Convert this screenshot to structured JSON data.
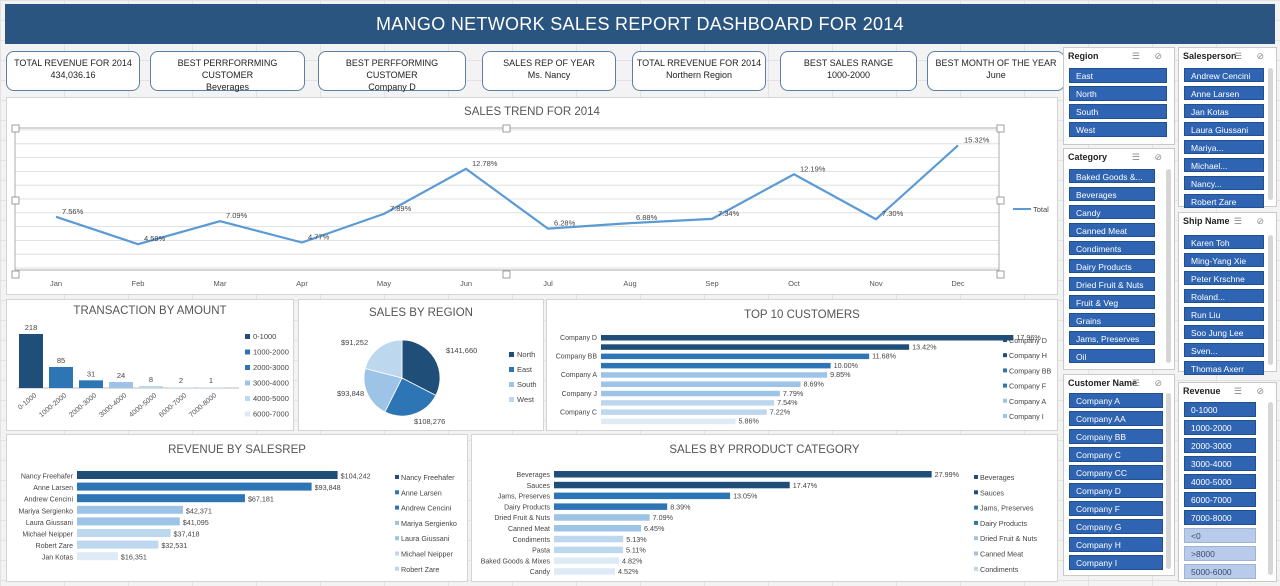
{
  "title": "MANGO NETWORK SALES REPORT DASHBOARD FOR 2014",
  "kpis": [
    {
      "label": "TOTAL REVENUE FOR 2014",
      "value": "434,036.16"
    },
    {
      "label": "BEST PERRFORRMING CUSTOMER",
      "value": "Beverages"
    },
    {
      "label": "BEST PERFFORMING CUSTOMER",
      "value": "Company D"
    },
    {
      "label": "SALES REP OF YEAR",
      "value": "Ms. Nancy"
    },
    {
      "label": "TOTAL RREVENUE FOR 2014",
      "value": "Northern Region"
    },
    {
      "label": "BEST SALES RANGE",
      "value": "1000-2000"
    },
    {
      "label": "BEST MONTH OF THE YEAR",
      "value": "June"
    }
  ],
  "colors": {
    "dark": "#1f4e79",
    "mid": "#2e75b6",
    "light": "#9dc3e6",
    "lighter": "#bdd7ee",
    "lightest": "#deebf7",
    "line": "#5b9bd5",
    "slicer": "#2f64b2"
  },
  "chart_data": [
    {
      "type": "line",
      "title": "SALES TREND FOR 2014",
      "categories": [
        "Jan",
        "Feb",
        "Mar",
        "Apr",
        "May",
        "Jun",
        "Jul",
        "Aug",
        "Sep",
        "Oct",
        "Nov",
        "Dec"
      ],
      "series": [
        {
          "name": "Total",
          "values": [
            7.56,
            4.59,
            7.09,
            4.77,
            7.89,
            12.78,
            6.28,
            6.88,
            7.34,
            12.19,
            7.3,
            15.32
          ],
          "labels": [
            "7.56%",
            "4.59%",
            "7.09%",
            "4.77%",
            "7.89%",
            "12.78%",
            "6.28%",
            "6.88%",
            "7.34%",
            "12.19%",
            "7.30%",
            "15.32%"
          ]
        }
      ],
      "grid": true,
      "legend": "right"
    },
    {
      "type": "bar",
      "title": "TRANSACTION BY AMOUNT",
      "categories": [
        "0-1000",
        "1000-2000",
        "2000-3000",
        "3000-4000",
        "4000-5000",
        "6000-7000",
        "7000-8000"
      ],
      "values": [
        218,
        85,
        31,
        24,
        8,
        2,
        1
      ],
      "legend": [
        "0-1000",
        "1000-2000",
        "2000-3000",
        "3000-4000",
        "4000-5000",
        "6000-7000"
      ]
    },
    {
      "type": "pie",
      "title": "SALES BY REGION",
      "categories": [
        "North",
        "East",
        "South",
        "West"
      ],
      "values": [
        141660,
        108276,
        93848,
        91252
      ],
      "labels": [
        "$141,660",
        "$108,276",
        "$93,848",
        "$91,252"
      ]
    },
    {
      "type": "bar",
      "title": "TOP 10 CUSTOMERS",
      "categories": [
        "Company D",
        "",
        "Company BB",
        "",
        "Company A",
        "",
        "Company J",
        "",
        "Company C",
        ""
      ],
      "values": [
        17.96,
        13.42,
        11.68,
        10.0,
        9.85,
        8.69,
        7.79,
        7.54,
        7.22,
        5.86
      ],
      "labels": [
        "17.96%",
        "13.42%",
        "11.68%",
        "10.00%",
        "9.85%",
        "8.69%",
        "7.79%",
        "7.54%",
        "7.22%",
        "5.86%"
      ],
      "legend": [
        "Company D",
        "Company H",
        "Company BB",
        "Company F",
        "Company A",
        "Company I"
      ]
    },
    {
      "type": "bar",
      "title": "REVENUE BY SALESREP",
      "categories": [
        "Nancy Freehafer",
        "Anne Larsen",
        "Andrew Cencini",
        "Mariya Sergienko",
        "Laura Giussani",
        "Michael Neipper",
        "Robert Zare",
        "Jan Kotas"
      ],
      "values": [
        104242,
        93848,
        67181,
        42371,
        41095,
        37418,
        32531,
        16351
      ],
      "labels": [
        "$104,242",
        "$93,848",
        "$67,181",
        "$42,371",
        "$41,095",
        "$37,418",
        "$32,531",
        "$16,351"
      ],
      "legend": [
        "Nancy Freehafer",
        "Anne Larsen",
        "Andrew Cencini",
        "Mariya Sergienko",
        "Laura Giussani",
        "Michael Neipper",
        "Robert Zare"
      ]
    },
    {
      "type": "bar",
      "title": "SALES BY PRRODUCT CATEGORY",
      "categories": [
        "Beverages",
        "Sauces",
        "Jams, Preserves",
        "Dairy Products",
        "Dried Fruit & Nuts",
        "Canned Meat",
        "Condiments",
        "Pasta",
        "Baked Goods & Mixes",
        "Candy"
      ],
      "values": [
        27.99,
        17.47,
        13.05,
        8.39,
        7.09,
        6.45,
        5.13,
        5.11,
        4.82,
        4.52
      ],
      "labels": [
        "27.99%",
        "17.47%",
        "13.05%",
        "8.39%",
        "7.09%",
        "6.45%",
        "5.13%",
        "5.11%",
        "4.82%",
        "4.52%"
      ],
      "legend": [
        "Beverages",
        "Sauces",
        "Jams, Preserves",
        "Dairy Products",
        "Dried Fruit & Nuts",
        "Canned Meat",
        "Condiments"
      ]
    }
  ],
  "slicers": {
    "region": {
      "title": "Region",
      "items": [
        "East",
        "North",
        "South",
        "West"
      ]
    },
    "salesperson": {
      "title": "Salesperson",
      "items": [
        "Andrew Cencini",
        "Anne Larsen",
        "Jan Kotas",
        "Laura Giussani",
        "Mariya...",
        "Michael...",
        "Nancy...",
        "Robert Zare"
      ]
    },
    "category": {
      "title": "Category",
      "items": [
        "Baked Goods &...",
        "Beverages",
        "Candy",
        "Canned Meat",
        "Condiments",
        "Dairy Products",
        "Dried Fruit & Nuts",
        "Fruit & Veg",
        "Grains",
        "Jams, Preserves",
        "Oil"
      ]
    },
    "ship": {
      "title": "Ship Name",
      "items": [
        "Karen Toh",
        "Ming-Yang Xie",
        "Peter Krschne",
        "Roland...",
        "Run Liu",
        "Soo Jung Lee",
        "Sven...",
        "Thomas Axerr"
      ]
    },
    "customer": {
      "title": "Customer Name",
      "items": [
        "Company A",
        "Company AA",
        "Company BB",
        "Company C",
        "Company CC",
        "Company D",
        "Company F",
        "Company G",
        "Company H",
        "Company I"
      ]
    },
    "revenue": {
      "title": "Revenue",
      "items": [
        "0-1000",
        "1000-2000",
        "2000-3000",
        "3000-4000",
        "4000-5000",
        "6000-7000",
        "7000-8000",
        "<0",
        ">8000",
        "5000-6000"
      ],
      "off": [
        "<0",
        ">8000",
        "5000-6000"
      ]
    }
  }
}
